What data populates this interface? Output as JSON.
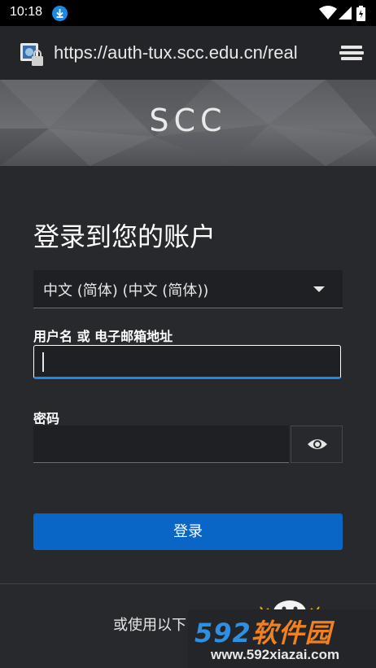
{
  "status_bar": {
    "time": "10:18",
    "icons": [
      "download-icon",
      "wifi-icon",
      "signal-icon",
      "battery-icon"
    ]
  },
  "browser": {
    "url": "https://auth-tux.scc.edu.cn/real",
    "site_icon": "lock-site-icon",
    "menu_icon": "tabs-menu-icon"
  },
  "banner": {
    "brand": "SCC"
  },
  "login": {
    "title": "登录到您的账户",
    "language_select": {
      "value": "中文 (简体) (中文 (简体))"
    },
    "username_label": "用户名 或 电子邮箱地址",
    "username_value": "",
    "password_label": "密码",
    "password_value": "",
    "submit_label": "登录",
    "alt_login_text": "或使用以下"
  },
  "watermark": {
    "number": "592",
    "chinese": "软件园",
    "url": "www.592xiazai.com"
  },
  "colors": {
    "accent": "#0a66c6",
    "panel": "#27292d",
    "input_focus": "#1e88e5"
  }
}
